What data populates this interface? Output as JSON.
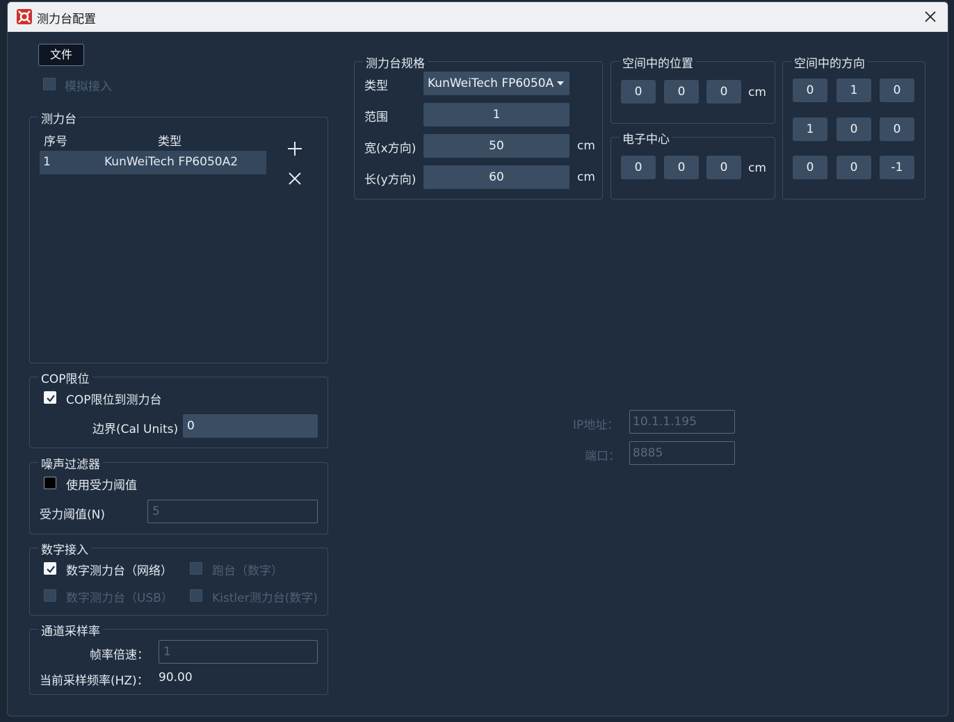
{
  "window": {
    "title": "测力台配置"
  },
  "toolbar": {
    "file_label": "文件"
  },
  "simulate": {
    "label": "模拟接入",
    "checked": false,
    "disabled": true
  },
  "plate_list": {
    "title": "测力台",
    "headers": [
      "序号",
      "类型"
    ],
    "rows": [
      {
        "index": "1",
        "type": "KunWeiTech FP6050A2"
      }
    ]
  },
  "cop": {
    "title": "COP限位",
    "limit_label": "COP限位到测力台",
    "limit_checked": true,
    "border_label": "边界(Cal Units)",
    "border_value": "0"
  },
  "noise": {
    "title": "噪声过滤器",
    "use_threshold_label": "使用受力阈值",
    "use_threshold_checked": false,
    "threshold_label": "受力阈值(N)",
    "threshold_placeholder": "5"
  },
  "digital": {
    "title": "数字接入",
    "network_label": "数字测力台（网络）",
    "network_checked": true,
    "treadmill_label": "跑台（数字）",
    "usb_label": "数字测力台（USB）",
    "kistler_label": "Kistler测力台(数字)"
  },
  "sampling": {
    "title": "通道采样率",
    "multiplier_label": "帧率倍速：",
    "multiplier_placeholder": "1",
    "current_label": "当前采样频率(HZ)：",
    "current_value": "90.00"
  },
  "spec": {
    "title": "测力台规格",
    "type_label": "类型",
    "type_value": "KunWeiTech FP6050A",
    "range_label": "范围",
    "range_value": "1",
    "width_label": "宽(x方向)",
    "width_value": "50",
    "length_label": "长(y方向)",
    "length_value": "60",
    "unit": "cm"
  },
  "position": {
    "title": "空间中的位置",
    "values": [
      "0",
      "0",
      "0"
    ],
    "unit": "cm"
  },
  "center": {
    "title": "电子中心",
    "values": [
      "0",
      "0",
      "0"
    ],
    "unit": "cm"
  },
  "orientation": {
    "title": "空间中的方向",
    "rows": [
      [
        "0",
        "1",
        "0"
      ],
      [
        "1",
        "0",
        "0"
      ],
      [
        "0",
        "0",
        "-1"
      ]
    ]
  },
  "network": {
    "ip_label": "IP地址：",
    "ip_placeholder": "10.1.1.195",
    "port_label": "端口：",
    "port_placeholder": "8885"
  },
  "colors": {
    "background": "#1f2d3e",
    "field": "#3a4d63",
    "accent": "#d0312d"
  }
}
